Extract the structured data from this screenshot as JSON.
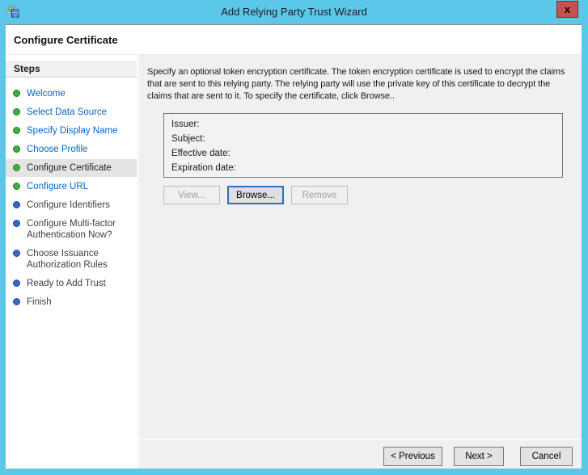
{
  "window": {
    "title": "Add Relying Party Trust Wizard",
    "close_label": "x",
    "heading": "Configure Certificate"
  },
  "sidebar": {
    "header": "Steps",
    "items": [
      {
        "label": "Welcome",
        "state": "done"
      },
      {
        "label": "Select Data Source",
        "state": "done"
      },
      {
        "label": "Specify Display Name",
        "state": "done"
      },
      {
        "label": "Choose Profile",
        "state": "done"
      },
      {
        "label": "Configure Certificate",
        "state": "current"
      },
      {
        "label": "Configure URL",
        "state": "done"
      },
      {
        "label": "Configure Identifiers",
        "state": "upcoming"
      },
      {
        "label": "Configure Multi-factor Authentication Now?",
        "state": "upcoming"
      },
      {
        "label": "Choose Issuance Authorization Rules",
        "state": "upcoming"
      },
      {
        "label": "Ready to Add Trust",
        "state": "upcoming"
      },
      {
        "label": "Finish",
        "state": "upcoming"
      }
    ]
  },
  "content": {
    "description": "Specify an optional token encryption certificate.  The token encryption certificate is used to encrypt the claims that are sent to this relying party.  The relying party will use the private key of this certificate to decrypt the claims that are sent to it.  To specify the certificate, click Browse..",
    "certificate_fields": [
      "Issuer:",
      "Subject:",
      "Effective date:",
      "Expiration date:"
    ],
    "buttons": {
      "view": "View...",
      "browse": "Browse...",
      "remove": "Remove"
    }
  },
  "footer": {
    "previous": "< Previous",
    "next": "Next >",
    "cancel": "Cancel"
  },
  "colors": {
    "frame_blue": "#5BC8EA",
    "close_red": "#C75050",
    "link_blue": "#0066CC",
    "done_bullet_green": "#3CB03C",
    "upcoming_bullet_blue": "#3467C6",
    "current_step_highlight": "#E4E4E4",
    "dialog_gray": "#F0F0F0",
    "browse_focus_border": "#2D6FC2"
  }
}
